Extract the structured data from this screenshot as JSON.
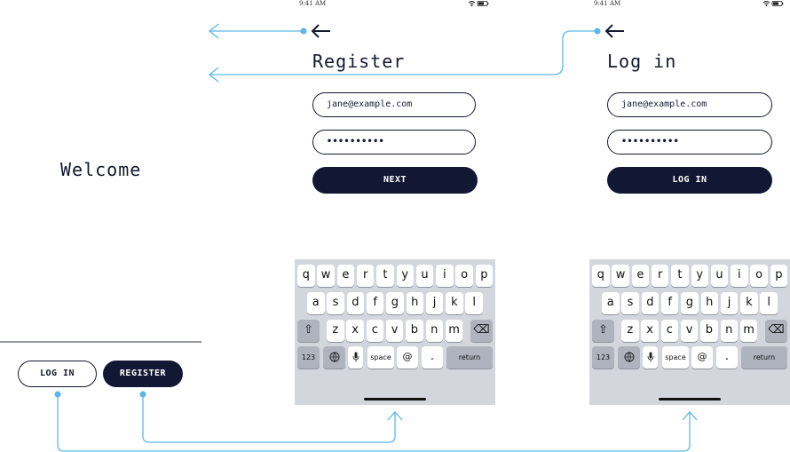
{
  "colors": {
    "accent": "#5cb7ea",
    "dark": "#121833",
    "keyboard": "#d3d6dd"
  },
  "welcome": {
    "title": "Welcome",
    "login_label": "LOG IN",
    "register_label": "REGISTER"
  },
  "register": {
    "time": "9:41 AM",
    "back_icon": "arrow-left-icon",
    "title": "Register",
    "email_value": "jane@example.com",
    "password_value": "••••••••••",
    "next_label": "NEXT"
  },
  "login": {
    "time": "9:41 AM",
    "back_icon": "arrow-left-icon",
    "title": "Log in",
    "email_value": "jane@example.com",
    "password_value": "••••••••••",
    "login_label": "LOG IN"
  },
  "keyboard": {
    "row1": [
      "q",
      "w",
      "e",
      "r",
      "t",
      "y",
      "u",
      "i",
      "o",
      "p"
    ],
    "row2": [
      "a",
      "s",
      "d",
      "f",
      "g",
      "h",
      "j",
      "k",
      "l"
    ],
    "row3": [
      "z",
      "x",
      "c",
      "v",
      "b",
      "n",
      "m"
    ],
    "num_label": "123",
    "space_label": "space",
    "at_label": "@",
    "dot_label": ".",
    "return_label": "return"
  }
}
